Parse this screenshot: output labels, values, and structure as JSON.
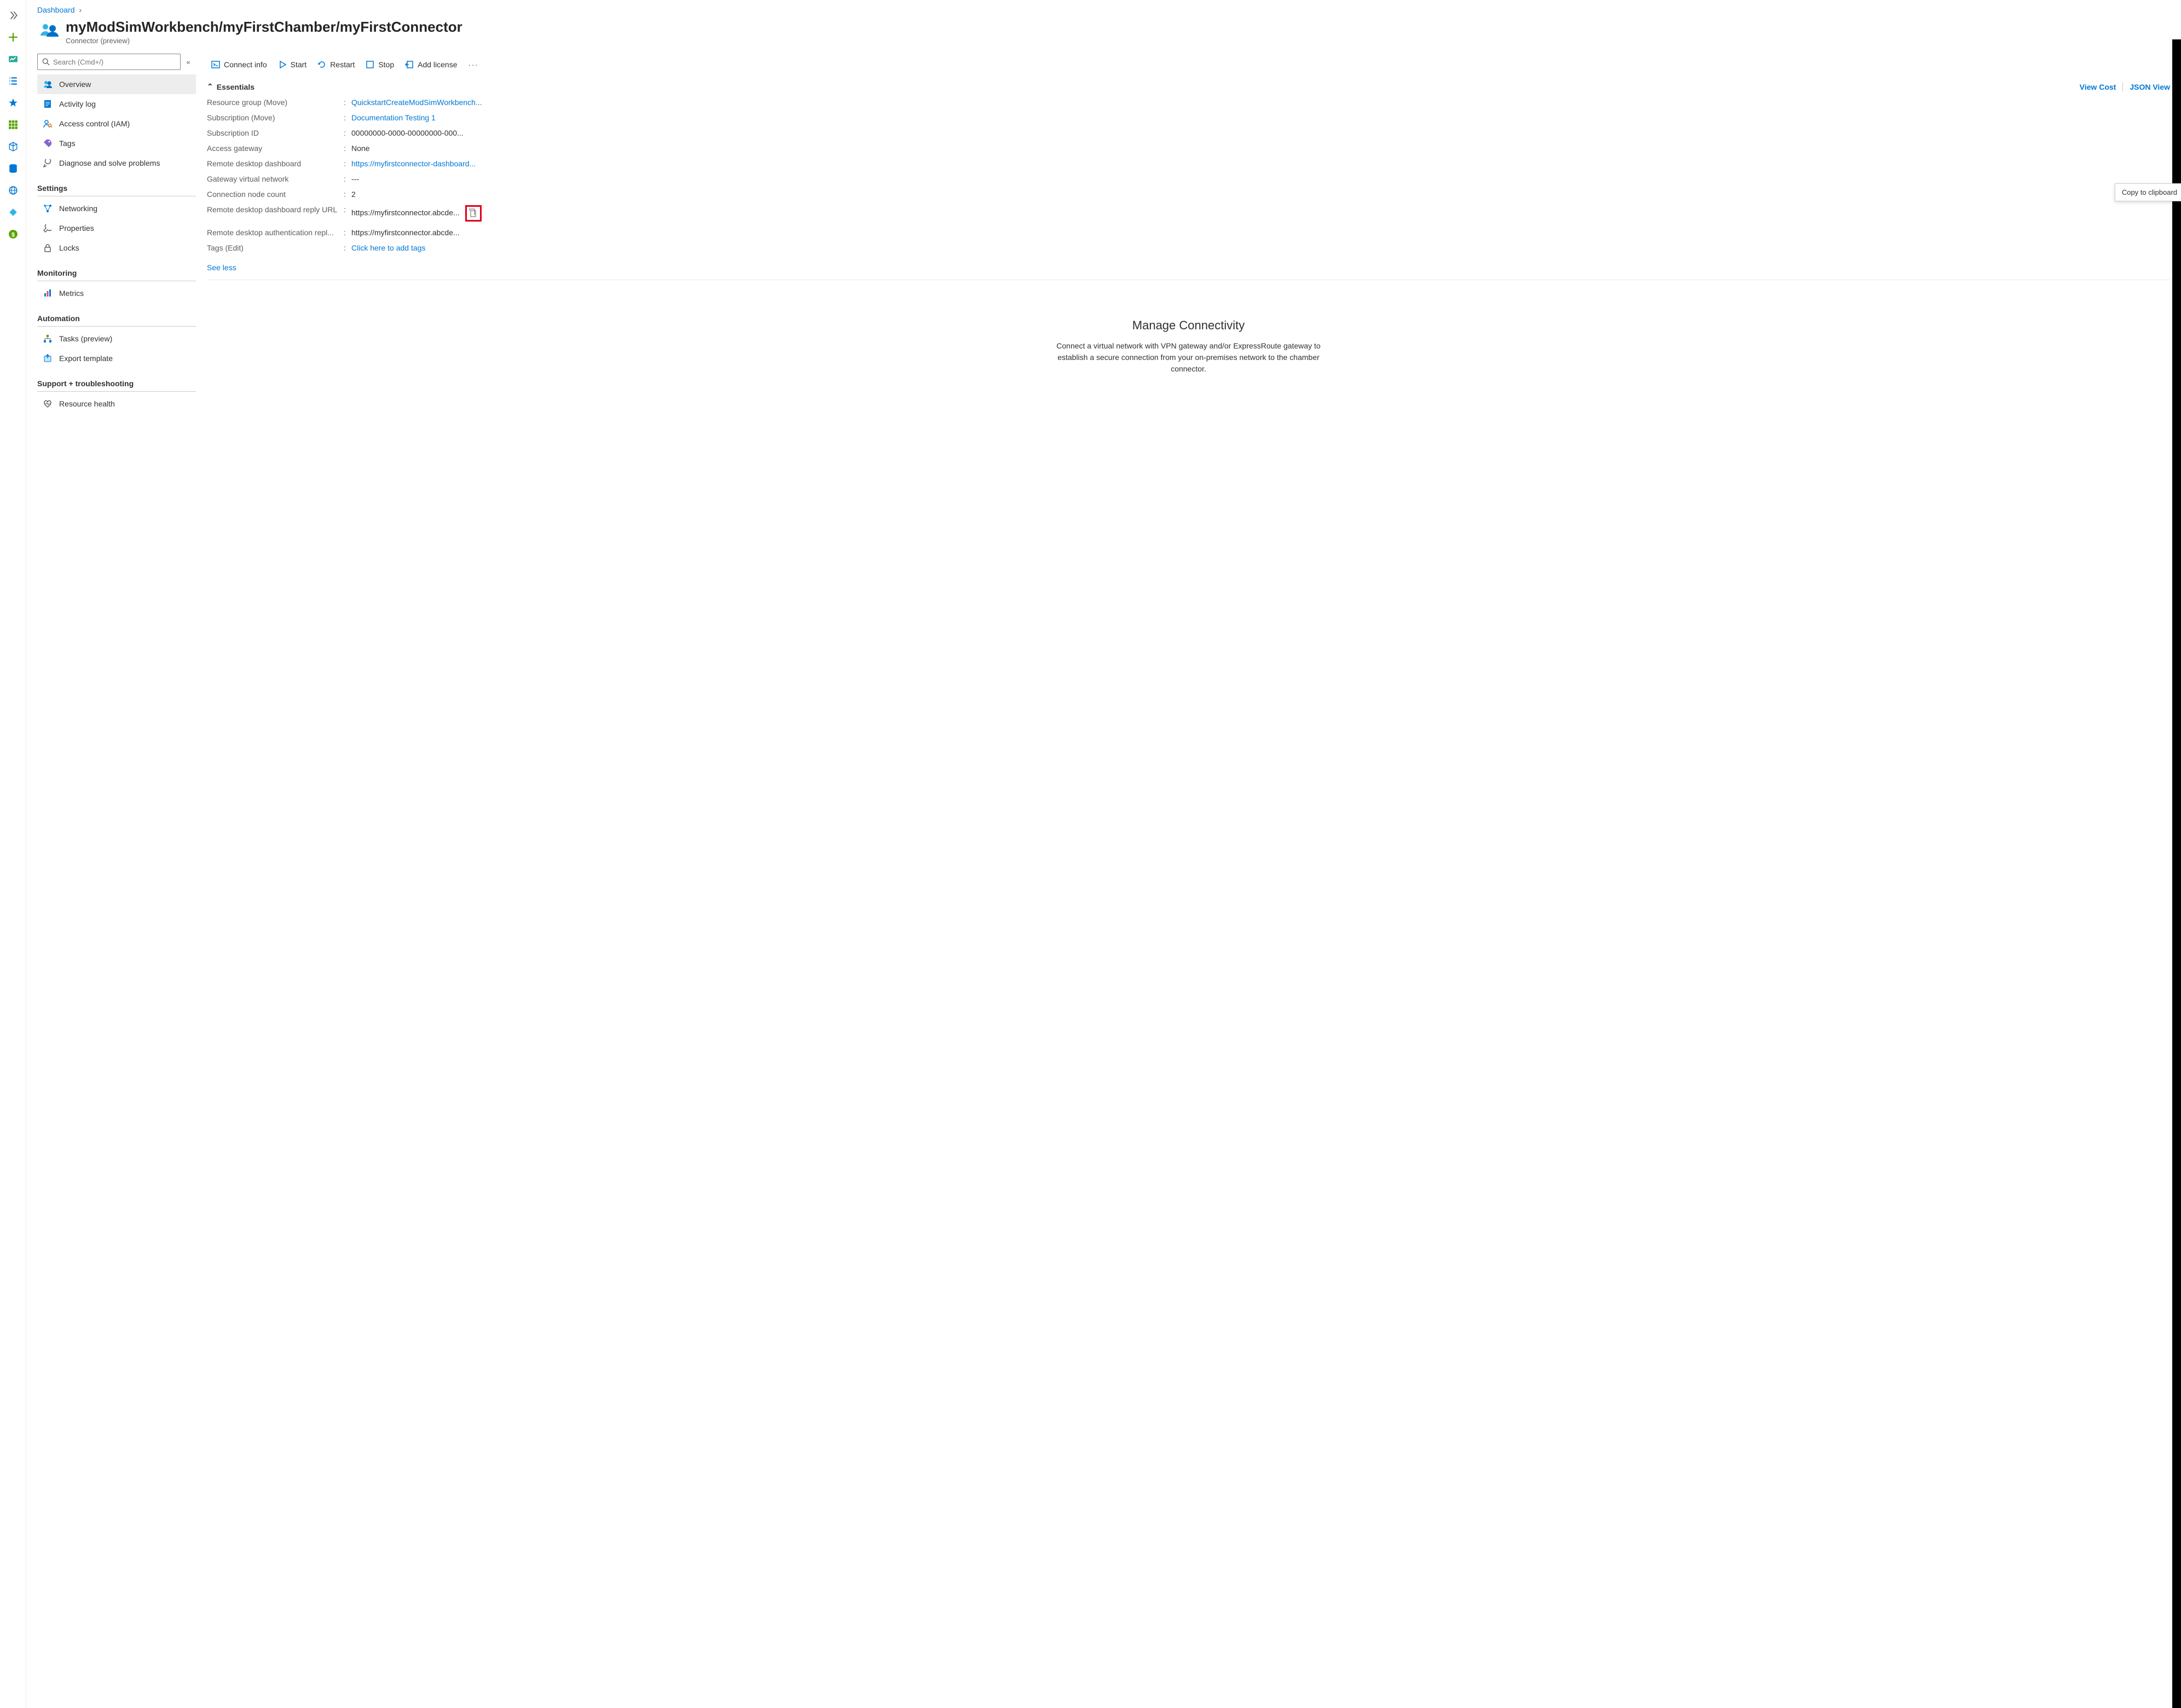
{
  "breadcrumb": {
    "root": "Dashboard"
  },
  "header": {
    "title": "myModSimWorkbench/myFirstChamber/myFirstConnector",
    "subtitle": "Connector (preview)"
  },
  "search": {
    "placeholder": "Search (Cmd+/)"
  },
  "nav": {
    "items": [
      {
        "label": "Overview"
      },
      {
        "label": "Activity log"
      },
      {
        "label": "Access control (IAM)"
      },
      {
        "label": "Tags"
      },
      {
        "label": "Diagnose and solve problems"
      }
    ],
    "settings_header": "Settings",
    "settings": [
      {
        "label": "Networking"
      },
      {
        "label": "Properties"
      },
      {
        "label": "Locks"
      }
    ],
    "monitoring_header": "Monitoring",
    "monitoring": [
      {
        "label": "Metrics"
      }
    ],
    "automation_header": "Automation",
    "automation": [
      {
        "label": "Tasks (preview)"
      },
      {
        "label": "Export template"
      }
    ],
    "support_header": "Support + troubleshooting",
    "support": [
      {
        "label": "Resource health"
      }
    ]
  },
  "toolbar": {
    "connect": "Connect info",
    "start": "Start",
    "restart": "Restart",
    "stop": "Stop",
    "addlicense": "Add license"
  },
  "essentials": {
    "header": "Essentials",
    "view_cost": "View Cost",
    "json_view": "JSON View",
    "rows": {
      "rg_key": "Resource group (",
      "rg_move": "Move",
      "rg_key_end": ")",
      "rg_val": "QuickstartCreateModSimWorkbench...",
      "sub_key": "Subscription (",
      "sub_move": "Move",
      "sub_key_end": ")",
      "sub_val": "Documentation Testing 1",
      "subid_key": "Subscription ID",
      "subid_val": "00000000-0000-00000000-000...",
      "gw_key": "Access gateway",
      "gw_val": "None",
      "rdd_key": "Remote desktop dashboard",
      "rdd_val": "https://myfirstconnector-dashboard...",
      "gvnet_key": "Gateway virtual network",
      "gvnet_val": "---",
      "cnc_key": "Connection node count",
      "cnc_val": "2",
      "rddr_key": "Remote desktop dashboard reply URL",
      "rddr_val": "https://myfirstconnector.abcde...",
      "rdar_key": "Remote desktop authentication repl...",
      "rdar_val": "https://myfirstconnector.abcde...",
      "tags_key": "Tags (",
      "tags_edit": "Edit",
      "tags_key_end": ")",
      "tags_val": "Click here to add tags"
    },
    "see_less": "See less",
    "tooltip": "Copy to clipboard"
  },
  "connectivity": {
    "title": "Manage Connectivity",
    "body": "Connect a virtual network with VPN gateway and/or ExpressRoute gateway to establish a secure connection from your on-premises network to the chamber connector."
  }
}
